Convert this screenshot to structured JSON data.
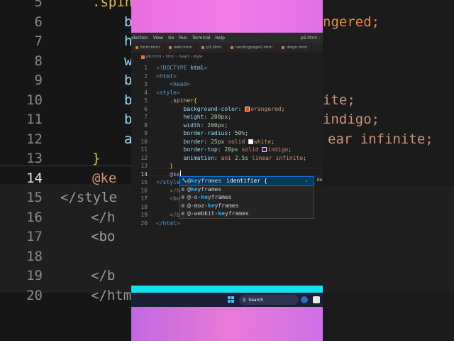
{
  "background": {
    "line_numbers": [
      "5",
      "6",
      "7",
      "8",
      "9",
      "10",
      "11",
      "12",
      "13",
      "14",
      "15",
      "16",
      "17",
      "18",
      "19",
      "20"
    ],
    "left_fragments": [
      {
        "text": ".spin",
        "cls": "sel"
      },
      {
        "text": "b",
        "cls": "kw"
      },
      {
        "text": "h",
        "cls": "kw"
      },
      {
        "text": "w",
        "cls": "kw"
      },
      {
        "text": "b",
        "cls": "kw"
      },
      {
        "text": "b",
        "cls": "kw"
      },
      {
        "text": "b",
        "cls": "kw"
      },
      {
        "text": "a",
        "cls": "kw"
      },
      {
        "text": "}",
        "cls": "brace"
      },
      {
        "text": "@ke",
        "cls": "at"
      },
      {
        "text": "</style",
        "cls": "tag"
      },
      {
        "text": "</h",
        "cls": "tag"
      },
      {
        "text": "<bo",
        "cls": "tag"
      },
      {
        "text": "",
        "cls": "tag"
      },
      {
        "text": "</b",
        "cls": "tag"
      },
      {
        "text": "</html>",
        "cls": "tag"
      }
    ],
    "right_fragments": [
      {
        "text": "ngered;",
        "cls": "orange"
      },
      {
        "text": "ite;",
        "cls": "val"
      },
      {
        "text": "indigo;",
        "cls": "val"
      },
      {
        "text": "ear infinite;",
        "cls": "val"
      }
    ]
  },
  "menubar": {
    "items": [
      "election",
      "View",
      "Go",
      "Run",
      "Terminal",
      "Help"
    ],
    "title": "p6.html -"
  },
  "tabs": [
    "form.html",
    "web.html",
    "p3.html",
    "landingpage1.html",
    "dsign.html"
  ],
  "breadcrumb": [
    "p6.html",
    "html",
    "head",
    "style"
  ],
  "editor": {
    "lines": [
      {
        "n": "1",
        "html": "<span class='t-gray'>&lt;!</span><span class='t-tag'>DOCTYPE</span> <span class='t-prop'>html</span><span class='t-gray'>&gt;</span>"
      },
      {
        "n": "2",
        "html": "<span class='t-gray'>&lt;</span><span class='t-tag'>html</span><span class='t-gray'>&gt;</span>"
      },
      {
        "n": "3",
        "html": "    <span class='t-gray'>&lt;</span><span class='t-tag'>head</span><span class='t-gray'>&gt;</span>"
      },
      {
        "n": "4",
        "html": "<span class='t-gray'>&lt;</span><span class='t-tag'>style</span><span class='t-gray'>&gt;</span>"
      },
      {
        "n": "5",
        "html": "    <span class='t-sel'>.spiner</span><span class='t-brace'>{</span>"
      },
      {
        "n": "6",
        "html": "        <span class='t-prop'>background-color</span>: <span class='sw' style='background:#ff4500'></span><span class='t-val'>orangered</span>;"
      },
      {
        "n": "7",
        "html": "        <span class='t-prop'>height</span>: <span class='t-num'>200px</span>;"
      },
      {
        "n": "8",
        "html": "        <span class='t-prop'>width</span>: <span class='t-num'>200px</span>;"
      },
      {
        "n": "9",
        "html": "        <span class='t-prop'>border-radius</span>: <span class='t-num'>50%</span>;"
      },
      {
        "n": "10",
        "html": "        <span class='t-prop'>border</span>: <span class='t-num'>25px</span> <span class='t-val'>solid</span> <span class='sw' style='background:#ffffff'></span><span class='t-val'>white</span>;"
      },
      {
        "n": "11",
        "html": "        <span class='t-prop'>border-top</span>: <span class='t-num'>20px</span> <span class='t-val'>solid</span> <span class='sw' style='background:#4b0082'></span><span class='t-val'>indigo</span>;"
      },
      {
        "n": "12",
        "html": "        <span class='t-prop'>animation</span>: <span class='t-val'>ani</span> <span class='t-num'>2.5s</span> <span class='t-val'>linear infinite</span>;"
      },
      {
        "n": "13",
        "html": "    <span class='t-brace'>}</span>"
      },
      {
        "n": "14",
        "html": "    <span class='t-at'>@ke</span><span class='cursor'></span>"
      },
      {
        "n": "15",
        "html": "<span class='t-gray'>&lt;/</span><span class='t-tag'>style</span>"
      },
      {
        "n": "16",
        "html": "    <span class='t-gray'>&lt;/</span><span class='t-tag'>h</span>"
      },
      {
        "n": "17",
        "html": "    <span class='t-gray'>&lt;</span><span class='t-tag'>bo</span>"
      },
      {
        "n": "18",
        "html": ""
      },
      {
        "n": "19",
        "html": "    <span class='t-gray'>&lt;/</span><span class='t-tag'>b</span>"
      },
      {
        "n": "20",
        "html": "<span class='t-gray'>&lt;/</span><span class='t-tag'>html</span><span class='t-gray'>&gt;</span>"
      }
    ],
    "current_line": "14"
  },
  "suggestions": {
    "items": [
      {
        "prefix": "@",
        "match": "ke",
        "rest": "yframes",
        "detail": " identifier {",
        "selected": true
      },
      {
        "prefix": "@",
        "match": "ke",
        "rest": "yframes",
        "detail": "",
        "selected": false
      },
      {
        "prefix": "@-o-",
        "match": "ke",
        "rest": "yframes",
        "detail": "",
        "selected": false
      },
      {
        "prefix": "@-moz-",
        "match": "ke",
        "rest": "yframes",
        "detail": "",
        "selected": false
      },
      {
        "prefix": "@-webkit-",
        "match": "ke",
        "rest": "yframes",
        "detail": "",
        "selected": false
      }
    ],
    "right_label": "En"
  },
  "taskbar": {
    "search_placeholder": "Search"
  },
  "colors": {
    "accent_cyan": "#14e0f0",
    "selection": "#04395e",
    "match": "#2aaaff"
  }
}
